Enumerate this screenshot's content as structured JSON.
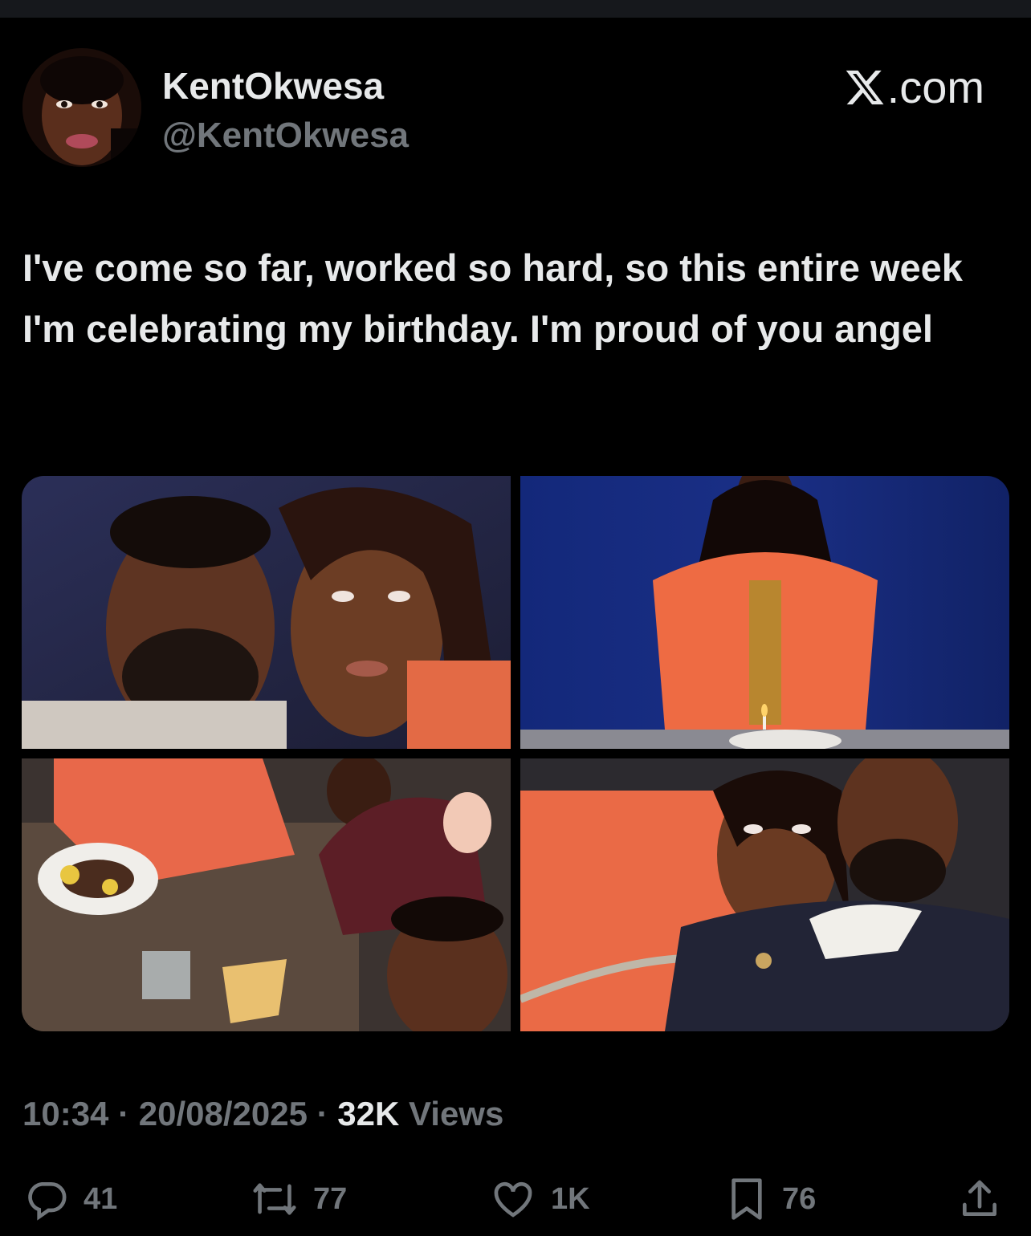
{
  "header": {
    "display_name": "KentOkwesa",
    "handle": "@KentOkwesa",
    "brand": ".com",
    "avatar_icon": "profile-photo"
  },
  "tweet": {
    "text": "I've come so far, worked so hard, so this entire week I'm celebrating my birthday. I'm proud of you angel"
  },
  "media": {
    "photos": [
      {
        "alt": "photo-1"
      },
      {
        "alt": "photo-2"
      },
      {
        "alt": "photo-3"
      },
      {
        "alt": "photo-4"
      }
    ]
  },
  "meta": {
    "time": "10:34",
    "sep1": " · ",
    "date": "20/08/2025",
    "sep2": " · ",
    "views_count": "32K",
    "views_label": " Views"
  },
  "actions": {
    "replies": "41",
    "reposts": "77",
    "likes": "1K",
    "bookmarks": "76"
  },
  "colors": {
    "background": "#000000",
    "text_primary": "#e7e9ea",
    "text_secondary": "#71767b"
  }
}
